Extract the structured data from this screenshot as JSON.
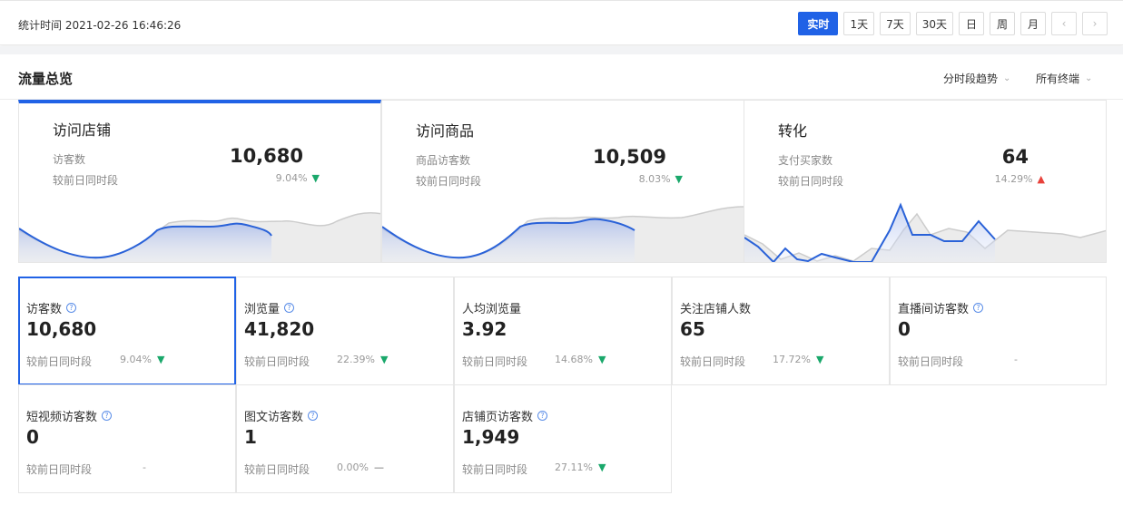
{
  "topbar": {
    "stat_time": "统计时间 2021-02-26 16:46:26",
    "periods": [
      "实时",
      "1天",
      "7天",
      "30天",
      "日",
      "周",
      "月"
    ],
    "prev": "‹",
    "next": "›"
  },
  "section": {
    "title": "流量总览",
    "trend_select": "分时段趋势",
    "terminal_select": "所有终端"
  },
  "overview": [
    {
      "title": "访问店铺",
      "label": "访客数",
      "value": "10,680",
      "compare_label": "较前日同时段",
      "change": "9.04%",
      "direction": "down"
    },
    {
      "title": "访问商品",
      "label": "商品访客数",
      "value": "10,509",
      "compare_label": "较前日同时段",
      "change": "8.03%",
      "direction": "down"
    },
    {
      "title": "转化",
      "label": "支付买家数",
      "value": "64",
      "compare_label": "较前日同时段",
      "change": "14.29%",
      "direction": "up"
    }
  ],
  "metrics": [
    {
      "label": "访客数",
      "value": "10,680",
      "compare_label": "较前日同时段",
      "change": "9.04%",
      "direction": "down",
      "help": true
    },
    {
      "label": "浏览量",
      "value": "41,820",
      "compare_label": "较前日同时段",
      "change": "22.39%",
      "direction": "down",
      "help": true
    },
    {
      "label": "人均浏览量",
      "value": "3.92",
      "compare_label": "较前日同时段",
      "change": "14.68%",
      "direction": "down",
      "help": false
    },
    {
      "label": "关注店铺人数",
      "value": "65",
      "compare_label": "较前日同时段",
      "change": "17.72%",
      "direction": "down",
      "help": false
    },
    {
      "label": "直播间访客数",
      "value": "0",
      "compare_label": "较前日同时段",
      "change": "-",
      "direction": "none",
      "help": true
    },
    {
      "label": "短视频访客数",
      "value": "0",
      "compare_label": "较前日同时段",
      "change": "-",
      "direction": "none",
      "help": true
    },
    {
      "label": "图文访客数",
      "value": "1",
      "compare_label": "较前日同时段",
      "change": "0.00%",
      "direction": "flat",
      "help": true
    },
    {
      "label": "店铺页访客数",
      "value": "1,949",
      "compare_label": "较前日同时段",
      "change": "27.11%",
      "direction": "down",
      "help": true
    }
  ],
  "icons": {
    "down": "▼",
    "up": "▲",
    "flat": "—",
    "help": "?",
    "chevron": "⌄"
  },
  "colors": {
    "accent": "#2062e6",
    "down": "#1aa86b",
    "up": "#e8413a",
    "line_today": "#2a62d8",
    "line_yesterday": "#cccccc"
  }
}
